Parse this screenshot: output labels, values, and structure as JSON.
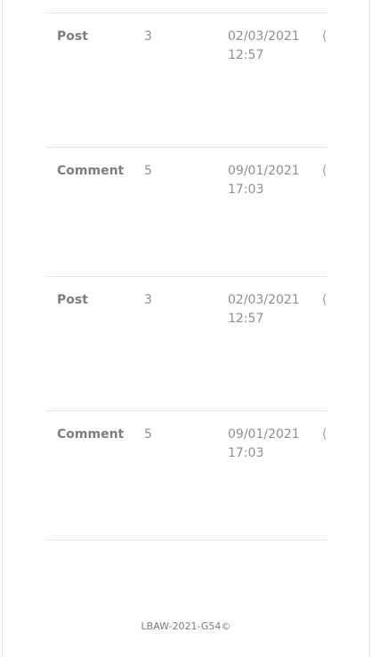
{
  "table": {
    "rows": [
      {
        "type": "Post",
        "count": "3",
        "date": "02/03/2021",
        "time": "12:57",
        "cut": "("
      },
      {
        "type": "Comment",
        "count": "5",
        "date": "09/01/2021",
        "time": "17:03",
        "cut": "("
      },
      {
        "type": "Post",
        "count": "3",
        "date": "02/03/2021",
        "time": "12:57",
        "cut": "("
      },
      {
        "type": "Comment",
        "count": "5",
        "date": "09/01/2021",
        "time": "17:03",
        "cut": "("
      }
    ]
  },
  "footer": {
    "text": "LBAW-2021-G54©"
  }
}
